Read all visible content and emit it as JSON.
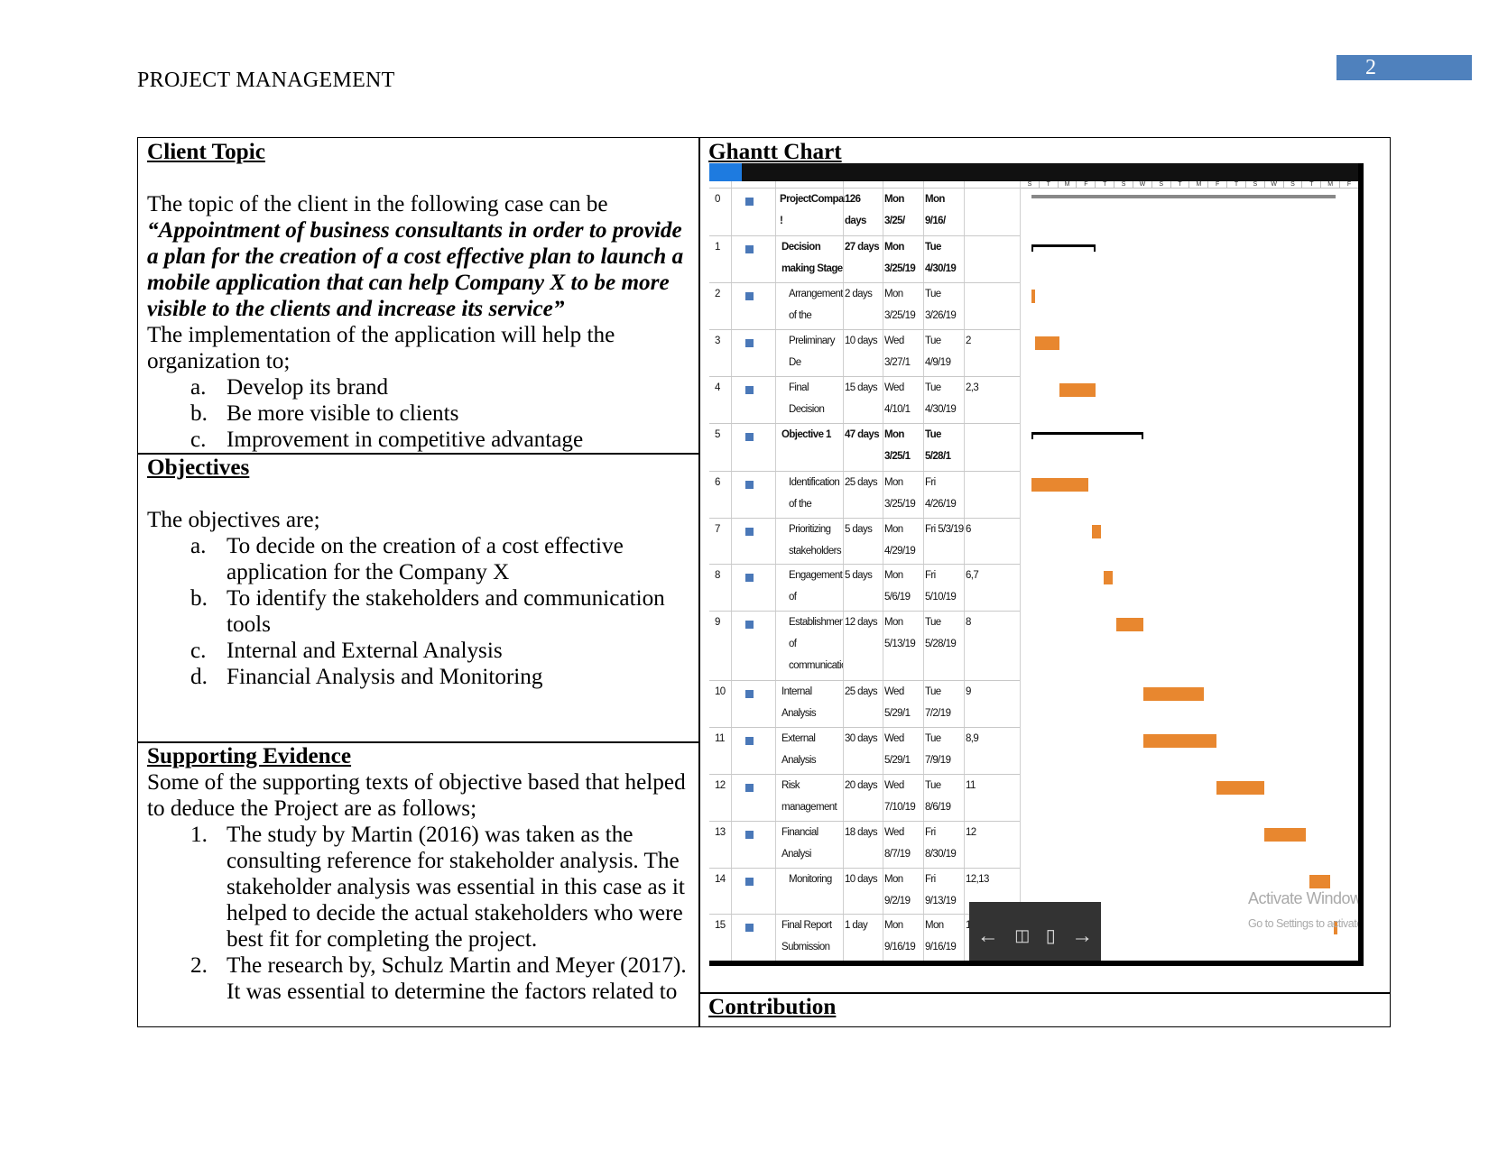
{
  "header": {
    "running_head": "PROJECT MANAGEMENT",
    "page_number": "2"
  },
  "client": {
    "title": "Client Topic",
    "intro": "The topic of the client in the following case can be",
    "quote": "“Appointment of business consultants in order to provide a plan for the creation of a cost effective plan to launch a mobile application that can help Company X to be more visible to the clients and increase its service”",
    "body": "The implementation of the application will help the organization to;",
    "items": [
      {
        "m": "a.",
        "t": "Develop its brand"
      },
      {
        "m": "b.",
        "t": "Be more visible to clients"
      },
      {
        "m": "c.",
        "t": "Improvement in competitive advantage"
      }
    ]
  },
  "objectives": {
    "title": "Objectives",
    "intro": "The objectives are;",
    "items": [
      {
        "m": "a.",
        "t": "To decide on the creation of a cost effective application for the Company X"
      },
      {
        "m": "b.",
        "t": "To identify the stakeholders and communication tools"
      },
      {
        "m": "c.",
        "t": "Internal and External Analysis"
      },
      {
        "m": "d.",
        "t": "Financial Analysis and Monitoring"
      }
    ]
  },
  "evidence": {
    "title": "Supporting Evidence",
    "intro": "Some of the supporting texts of objective based that helped to deduce the Project are as follows;",
    "items": [
      {
        "m": "1.",
        "t": "The study by Martin (2016) was taken as the consulting reference for stakeholder analysis. The stakeholder analysis was essential in this case as it helped to decide the actual stakeholders who were best fit for completing the project."
      },
      {
        "m": "2.",
        "t": "The research by, Schulz Martin and Meyer (2017). It was essential to determine the factors related to"
      }
    ]
  },
  "gantt_cell": {
    "title": "Ghantt Chart"
  },
  "contribution": {
    "title": "Contribution"
  },
  "chart_data": {
    "type": "gantt",
    "timeline_start": "2019-03-25",
    "timeline_end": "2019-09-16",
    "timescale_letters": [
      "S",
      "T",
      "M",
      "F",
      "T",
      "S",
      "W",
      "S",
      "T",
      "M",
      "F",
      "T",
      "S",
      "W",
      "S",
      "T",
      "M",
      "F"
    ],
    "bar_color": "#e8872f",
    "tasks": [
      {
        "id": "0",
        "name": "ProjectCompany !",
        "duration": "126 days",
        "start": "Mon 3/25/",
        "finish": "Mon 9/16/",
        "pred": "",
        "s": "2019-03-25",
        "f": "2019-09-16",
        "summary": "project"
      },
      {
        "id": "1",
        "name": "Decision making Stage",
        "duration": "27 days",
        "start": "Mon 3/25/19",
        "finish": "Tue 4/30/19",
        "pred": "",
        "s": "2019-03-25",
        "f": "2019-04-30",
        "summary": "yes"
      },
      {
        "id": "2",
        "name": "Arrangement of the",
        "duration": "2 days",
        "start": "Mon 3/25/19",
        "finish": "Tue 3/26/19",
        "pred": "",
        "s": "2019-03-25",
        "f": "2019-03-26"
      },
      {
        "id": "3",
        "name": "Preliminary De",
        "duration": "10 days",
        "start": "Wed 3/27/1",
        "finish": "Tue 4/9/19",
        "pred": "2",
        "s": "2019-03-27",
        "f": "2019-04-09"
      },
      {
        "id": "4",
        "name": "Final Decision",
        "duration": "15 days",
        "start": "Wed 4/10/1",
        "finish": "Tue 4/30/19",
        "pred": "2,3",
        "s": "2019-04-10",
        "f": "2019-04-30"
      },
      {
        "id": "5",
        "name": "Objective 1",
        "duration": "47 days",
        "start": "Mon 3/25/1",
        "finish": "Tue 5/28/1",
        "pred": "",
        "s": "2019-03-25",
        "f": "2019-05-28",
        "summary": "yes"
      },
      {
        "id": "6",
        "name": "Identification of the",
        "duration": "25 days",
        "start": "Mon 3/25/19",
        "finish": "Fri 4/26/19",
        "pred": "",
        "s": "2019-03-25",
        "f": "2019-04-26"
      },
      {
        "id": "7",
        "name": "Prioritizing stakeholders",
        "duration": "5 days",
        "start": "Mon 4/29/19",
        "finish": "Fri 5/3/19",
        "pred": "6",
        "s": "2019-04-29",
        "f": "2019-05-03"
      },
      {
        "id": "8",
        "name": "Engagement of",
        "duration": "5 days",
        "start": "Mon 5/6/19",
        "finish": "Fri 5/10/19",
        "pred": "6,7",
        "s": "2019-05-06",
        "f": "2019-05-10"
      },
      {
        "id": "9",
        "name": "Establishment of communicatio",
        "duration": "12 days",
        "start": "Mon 5/13/19",
        "finish": "Tue 5/28/19",
        "pred": "8",
        "s": "2019-05-13",
        "f": "2019-05-28"
      },
      {
        "id": "10",
        "name": "Internal Analysis",
        "duration": "25 days",
        "start": "Wed 5/29/1",
        "finish": "Tue 7/2/19",
        "pred": "9",
        "s": "2019-05-29",
        "f": "2019-07-02"
      },
      {
        "id": "11",
        "name": "External Analysis",
        "duration": "30 days",
        "start": "Wed 5/29/1",
        "finish": "Tue 7/9/19",
        "pred": "8,9",
        "s": "2019-05-29",
        "f": "2019-07-09"
      },
      {
        "id": "12",
        "name": "Risk management",
        "duration": "20 days",
        "start": "Wed 7/10/19",
        "finish": "Tue 8/6/19",
        "pred": "11",
        "s": "2019-07-10",
        "f": "2019-08-06"
      },
      {
        "id": "13",
        "name": "Financial Analysi",
        "duration": "18 days",
        "start": "Wed 8/7/19",
        "finish": "Fri 8/30/19",
        "pred": "12",
        "s": "2019-08-07",
        "f": "2019-08-30"
      },
      {
        "id": "14",
        "name": "Monitoring",
        "duration": "10 days",
        "start": "Mon 9/2/19",
        "finish": "Fri 9/13/19",
        "pred": "12,13",
        "s": "2019-09-02",
        "f": "2019-09-13"
      },
      {
        "id": "15",
        "name": "Final Report Submission",
        "duration": "1 day",
        "start": "Mon 9/16/19",
        "finish": "Mon 9/16/19",
        "pred": "1",
        "s": "2019-09-16",
        "f": "2019-09-16"
      }
    ]
  },
  "overlay": {
    "watermark_title": "Activate Windows",
    "watermark_sub": "Go to Settings to activate Windows",
    "toolbar_icons": [
      "arrow-left-icon",
      "rotate-icon",
      "delete-icon",
      "arrow-right-icon"
    ]
  }
}
